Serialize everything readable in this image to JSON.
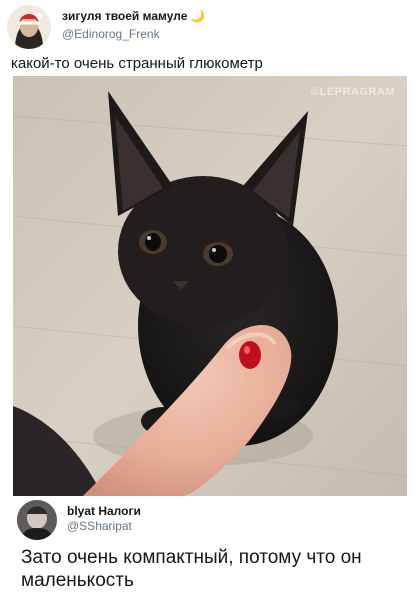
{
  "tweet1": {
    "display_name": "зигуля твоей мамуле",
    "moon_icon": "🌙",
    "handle": "@Edinorog_Frenk",
    "text": "какой-то очень странный глюкометр",
    "photo": {
      "watermark": "©LEPRAGRAM",
      "description_icon": "kitten-photo"
    }
  },
  "tweet2": {
    "display_name": "blyat Налоги",
    "handle": "@SSharipat",
    "text": "Зато очень компактный, потому что он маленькость"
  },
  "colors": {
    "name": "#14171a",
    "handle": "#657786",
    "background": "#ffffff"
  }
}
